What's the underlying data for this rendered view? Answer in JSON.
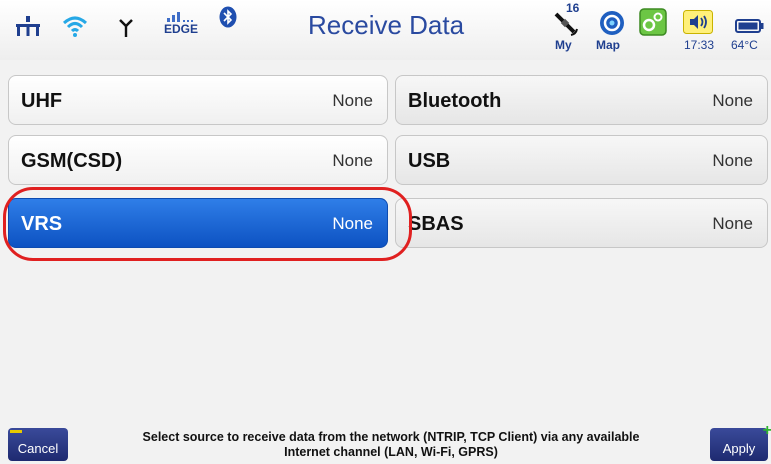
{
  "header": {
    "title": "Receive Data",
    "network_label": "EDGE",
    "satellite_count": "16",
    "my_label": "My",
    "map_label": "Map",
    "time": "17:33",
    "temperature": "64°C"
  },
  "sources": {
    "uhf": {
      "name": "UHF",
      "value": "None"
    },
    "bluetooth": {
      "name": "Bluetooth",
      "value": "None"
    },
    "gsm": {
      "name": "GSM(CSD)",
      "value": "None"
    },
    "usb": {
      "name": "USB",
      "value": "None"
    },
    "vrs": {
      "name": "VRS",
      "value": "None"
    },
    "sbas": {
      "name": "SBAS",
      "value": "None"
    }
  },
  "footer": {
    "cancel_label": "Cancel",
    "apply_label": "Apply",
    "hint_line1": "Select source to receive data from the network (NTRIP, TCP Client) via any available",
    "hint_line2": "Internet channel (LAN, Wi-Fi, GPRS)"
  },
  "colors": {
    "selected_bg": "#1a66d6",
    "highlight_ring": "#e02020",
    "title": "#2a4aa0"
  },
  "icons": [
    "network-icon",
    "wifi-icon",
    "antenna-icon",
    "signal-icon",
    "bluetooth-icon",
    "satellite-icon",
    "map-icon",
    "settings-icon",
    "speaker-icon",
    "battery-icon"
  ]
}
